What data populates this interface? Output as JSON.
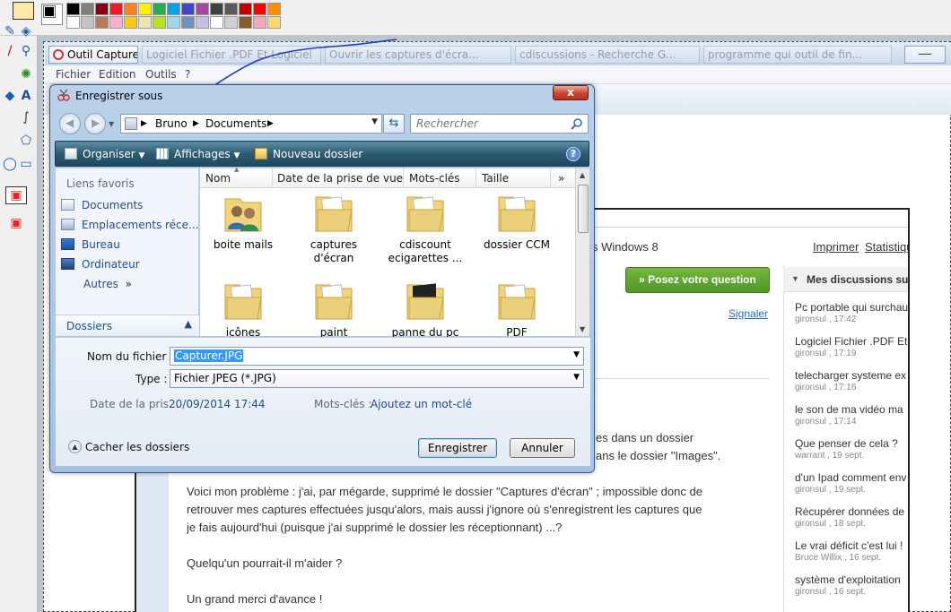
{
  "paint": {
    "palette_colors": [
      "#000000",
      "#7f7f7f",
      "#880015",
      "#ed1c24",
      "#ff7f27",
      "#fff200",
      "#22b14c",
      "#00a2e8",
      "#3f48cc",
      "#a349a4",
      "#ffffff",
      "#c3c3c3",
      "#b97a57",
      "#ffaec9",
      "#ffc90e",
      "#efe4b0",
      "#b5e61d",
      "#99d9ea",
      "#7092be",
      "#c8bfe7"
    ],
    "extra_colors": [
      "#404040",
      "#5a5a5a",
      "#c00000",
      "#ff0000",
      "#ff8c00",
      "#ffd700",
      "#00a000",
      "#0070c0",
      "#2f3da8",
      "#6a1b9a",
      "#ffffff",
      "#d0d0d0",
      "#8b5a2b",
      "#f4a7b9",
      "#ffd86b"
    ]
  },
  "background_app": {
    "tabs": [
      {
        "label": "Outil Capture"
      },
      {
        "label": "Logiciel Fichier .PDF Et Logiciel"
      },
      {
        "label": "Ouvrir les captures d'écra..."
      },
      {
        "label": "cdiscussions - Recherche G..."
      },
      {
        "label": "programme qui outil de fin..."
      }
    ],
    "menu": [
      "Fichier",
      "Edition",
      "Outils",
      "?"
    ]
  },
  "forum": {
    "top_text": "s Windows 8",
    "print_link": "Imprimer",
    "stats_link": "Statistiqu",
    "ask_button": "» Posez votre question",
    "report_link": "Signaler",
    "line1": "es dans un dossier",
    "line2": "ans le dossier \"Images\".",
    "para1_l1": "Voici mon problème : j'ai, par mégarde, supprimé le dossier \"Captures d'écran\" ; impossible donc de",
    "para1_l2": "retrouver mes captures effectuées jusqu'alors, mais aussi j'ignore où s'enregistrent les captures que",
    "para1_l3": "je fais aujourd'hui (puisque j'ai supprimé le dossier les réceptionnant) ...?",
    "para2": "Quelqu'un pourrait-il m'aider ?",
    "para3": "Un grand merci d'avance !",
    "sidebar_title": "Mes discussions su",
    "discussions": [
      {
        "title": "Pc portable qui surchau",
        "meta": "gironsul , 17:42"
      },
      {
        "title": "Logiciel Fichier .PDF Et",
        "meta": "gironsul , 17:19"
      },
      {
        "title": "telecharger systeme ex",
        "meta": "gironsul , 17:16"
      },
      {
        "title": "le son de ma vidéo ma",
        "meta": "gironsul , 17:14"
      },
      {
        "title": "Que penser de cela ?",
        "meta": "warrant , 19 sept."
      },
      {
        "title": "d'un Ipad comment env",
        "meta": "gironsul , 19 sept."
      },
      {
        "title": "Récupérer données de",
        "meta": "gironsul , 18 sept."
      },
      {
        "title": "Le vrai déficit c'est lui !",
        "meta": "Bruce Willix , 16 sept."
      },
      {
        "title": "système d'exploitation",
        "meta": "gironsul , 16 sept."
      }
    ]
  },
  "dialog": {
    "title": "Enregistrer sous",
    "close": "x",
    "breadcrumb": [
      "Bruno",
      "Documents"
    ],
    "search_placeholder": "Rechercher",
    "toolbar": {
      "organize": "Organiser",
      "views": "Affichages",
      "new_folder": "Nouveau dossier",
      "help": "?"
    },
    "nav": {
      "favorites_header": "Liens favoris",
      "items": [
        "Documents",
        "Emplacements réce...",
        "Bureau",
        "Ordinateur"
      ],
      "more": "Autres",
      "folders": "Dossiers"
    },
    "columns": [
      "Nom",
      "Date de la prise de vue",
      "Mots-clés",
      "Taille"
    ],
    "files": [
      {
        "name": "boite mails",
        "icon": "users-folder-icon"
      },
      {
        "name": "captures d'écran",
        "icon": "folder-icon"
      },
      {
        "name": "cdiscount ecigarettes ...",
        "icon": "folder-icon"
      },
      {
        "name": "dossier CCM",
        "icon": "folder-icon"
      },
      {
        "name": "icônes",
        "icon": "folder-icon"
      },
      {
        "name": "paint",
        "icon": "folder-icon"
      },
      {
        "name": "panne du pc",
        "icon": "dark-folder-icon"
      },
      {
        "name": "PDF",
        "icon": "folder-icon"
      }
    ],
    "filename_label": "Nom du fichier :",
    "filename_value": "Capturer.JPG",
    "type_label": "Type :",
    "type_value": "Fichier JPEG (*.JPG)",
    "date_label": "Date de la pris...",
    "date_value": "20/09/2014 17:44",
    "tags_label": "Mots-clés :",
    "tags_value": "Ajoutez un mot-clé",
    "hide_folders": "Cacher les dossiers",
    "save": "Enregistrer",
    "cancel": "Annuler"
  }
}
